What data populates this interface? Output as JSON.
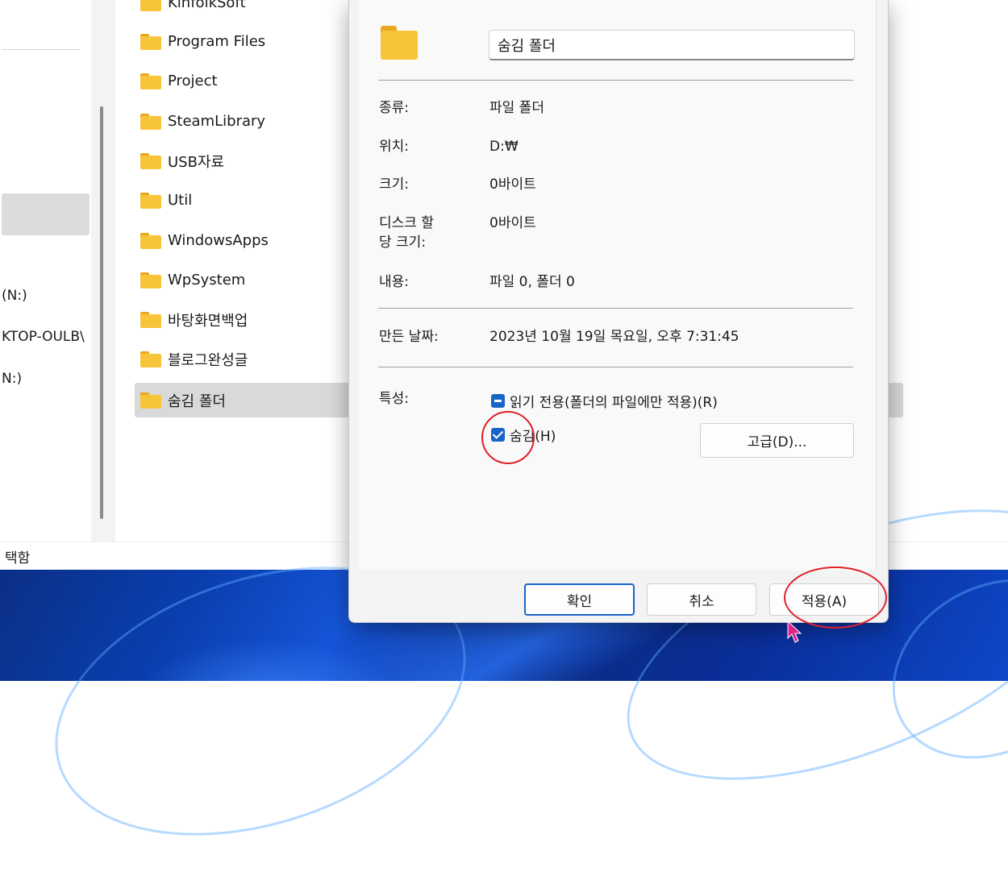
{
  "explorer": {
    "nav_items": [
      "(N:)",
      "KTOP-OULB\\",
      "N:)"
    ],
    "status_text": "택함",
    "top_folder_partial": "KinfolkSoft",
    "folders": [
      "Program Files",
      "Project",
      "SteamLibrary",
      "USB자료",
      "Util",
      "WindowsApps",
      "WpSystem",
      "바탕화면백업",
      "블로그완성글",
      "숨김 폴더"
    ],
    "selected_folder": "숨김 폴더"
  },
  "dialog": {
    "folder_name_value": "숨김 폴더",
    "props": {
      "type_label": "종류:",
      "type_value": "파일 폴더",
      "location_label": "위치:",
      "location_value": "D:₩",
      "size_label": "크기:",
      "size_value": "0바이트",
      "disk_size_label": "디스크 할\n당 크기:",
      "disk_size_value": "0바이트",
      "contents_label": "내용:",
      "contents_value": "파일 0, 폴더 0",
      "created_label": "만든 날짜:",
      "created_value": "2023년 10월 19일 목요일, 오후 7:31:45",
      "attributes_label": "특성:"
    },
    "attributes": {
      "readonly_label": "읽기 전용(폴더의 파일에만 적용)(R)",
      "readonly_state": "indeterminate",
      "hidden_label": "숨김(H)",
      "hidden_state": "checked",
      "advanced_button": "고급(D)..."
    },
    "buttons": {
      "ok": "확인",
      "cancel": "취소",
      "apply": "적용(A)"
    }
  },
  "colors": {
    "accent": "#1864c8",
    "annotation": "#e0202a",
    "folder": "#f8c43a",
    "cursor": "#e0208c"
  }
}
